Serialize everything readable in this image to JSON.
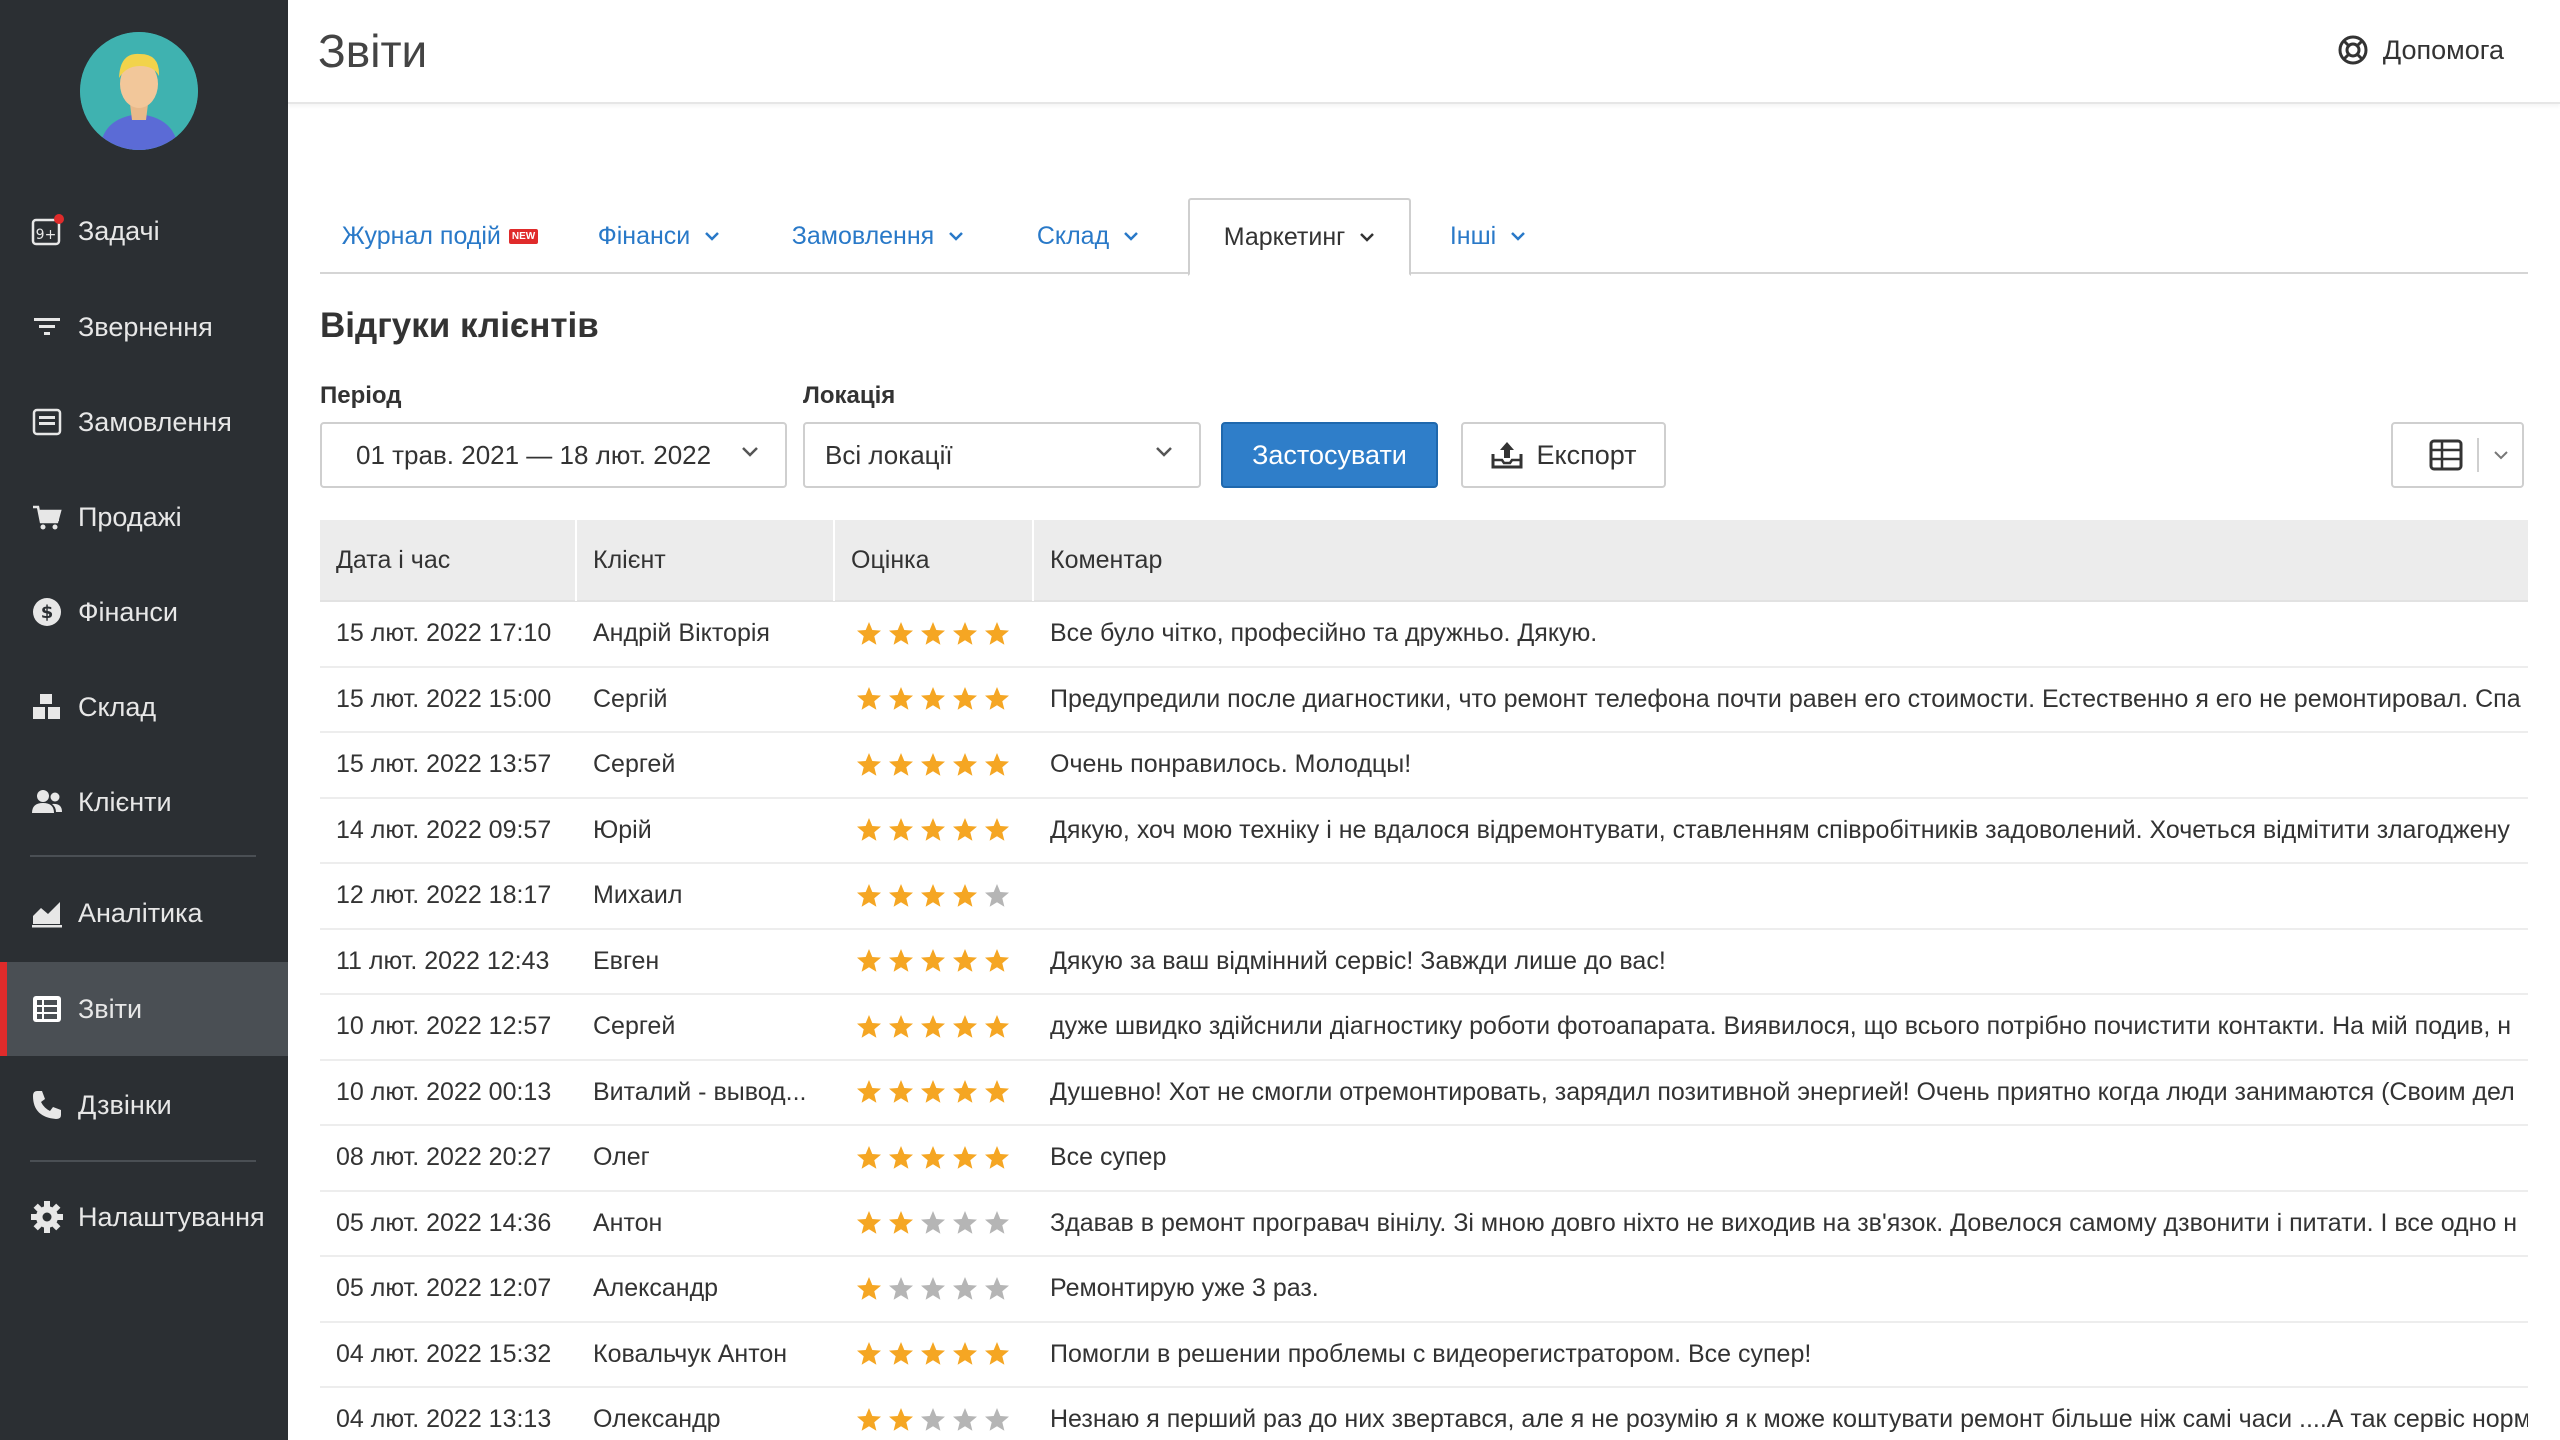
{
  "header": {
    "title": "Звіти",
    "help_label": "Допомога"
  },
  "sidebar": {
    "items": [
      {
        "label": "Задачі",
        "icon": "tasks-icon"
      },
      {
        "label": "Звернення",
        "icon": "filter-icon"
      },
      {
        "label": "Замовлення",
        "icon": "orders-icon"
      },
      {
        "label": "Продажі",
        "icon": "cart-icon"
      },
      {
        "label": "Фінанси",
        "icon": "dollar-icon"
      },
      {
        "label": "Склад",
        "icon": "boxes-icon"
      },
      {
        "label": "Клієнти",
        "icon": "users-icon"
      },
      {
        "label": "Аналітика",
        "icon": "chart-icon"
      },
      {
        "label": "Звіти",
        "icon": "reports-icon"
      },
      {
        "label": "Дзвінки",
        "icon": "phone-icon"
      },
      {
        "label": "Налаштування",
        "icon": "gear-icon"
      }
    ],
    "tasks_badge": "9+",
    "active": "Звіти"
  },
  "tabs": [
    {
      "label": "Журнал подій",
      "badge": "NEW"
    },
    {
      "label": "Фінанси"
    },
    {
      "label": "Замовлення"
    },
    {
      "label": "Склад"
    },
    {
      "label": "Маркетинг"
    },
    {
      "label": "Інші"
    }
  ],
  "active_tab": "Маркетинг",
  "section_title": "Відгуки клієнтів",
  "filters": {
    "period_label": "Період",
    "period_value": "01 трав. 2021 — 18 лют. 2022",
    "location_label": "Локація",
    "location_value": "Всі локації",
    "apply_label": "Застосувати",
    "export_label": "Експорт"
  },
  "table": {
    "columns": [
      "Дата і час",
      "Клієнт",
      "Оцінка",
      "Коментар"
    ],
    "rows": [
      {
        "date": "15 лют. 2022 17:10",
        "client": "Андрій Вікторія",
        "rating": 5,
        "comment": "Все було чітко, професійно та дружньо. Дякую."
      },
      {
        "date": "15 лют. 2022 15:00",
        "client": "Сергій",
        "rating": 5,
        "comment": "Предупредили после диагностики, что ремонт телефона почти равен его стоимости. Естественно я его не ремонтировал. Спа"
      },
      {
        "date": "15 лют. 2022 13:57",
        "client": "Сергей",
        "rating": 5,
        "comment": "Очень понравилось. Молодцы!"
      },
      {
        "date": "14 лют. 2022 09:57",
        "client": "Юрій",
        "rating": 5,
        "comment": "Дякую, хоч мою техніку і не вдалося відремонтувати, ставленням співробітників задоволений. Хочеться відмітити злагоджену"
      },
      {
        "date": "12 лют. 2022 18:17",
        "client": "Михаил",
        "rating": 4,
        "comment": ""
      },
      {
        "date": "11 лют. 2022 12:43",
        "client": "Евген",
        "rating": 5,
        "comment": "Дякую за ваш відмінний сервіс! Завжди лише до вас!"
      },
      {
        "date": "10 лют. 2022 12:57",
        "client": "Сергей",
        "rating": 5,
        "comment": "дуже швидко здійснили діагностику роботи фотоапарата. Виявилося, що всього потрібно почистити контакти. На мій подив, н"
      },
      {
        "date": "10 лют. 2022 00:13",
        "client": "Виталий - вывод...",
        "rating": 5,
        "comment": "Душевно! Хот не смогли отремонтировать, зарядил позитивной энергией! Очень приятно когда люди занимаются (Своим дел"
      },
      {
        "date": "08 лют. 2022 20:27",
        "client": "Олег",
        "rating": 5,
        "comment": "Все супер"
      },
      {
        "date": "05 лют. 2022 14:36",
        "client": "Антон",
        "rating": 2,
        "comment": "Здавав в ремонт програвач вінілу. Зі мною довго ніхто не виходив на зв'язок. Довелося самому дзвонити і питати. І все одно н"
      },
      {
        "date": "05 лют. 2022 12:07",
        "client": "Александр",
        "rating": 1,
        "comment": "Ремонтирую уже 3 раз."
      },
      {
        "date": "04 лют. 2022 15:32",
        "client": "Ковальчук Антон",
        "rating": 5,
        "comment": "Помогли в решении проблемы с видеорегистратором. Все супер!"
      },
      {
        "date": "04 лют. 2022 13:13",
        "client": "Олександр",
        "rating": 2,
        "comment": "Незнаю я перший раз до них звертався, але я не розумію я к може коштувати ремонт більше ніж самі часи ....А так сервіс норм"
      }
    ]
  },
  "colors": {
    "star_filled": "#f5a623",
    "star_empty": "#b5b5b5",
    "primary": "#2f7ec9",
    "sidebar": "#2b2f33",
    "active_marker": "#e02b2b"
  }
}
